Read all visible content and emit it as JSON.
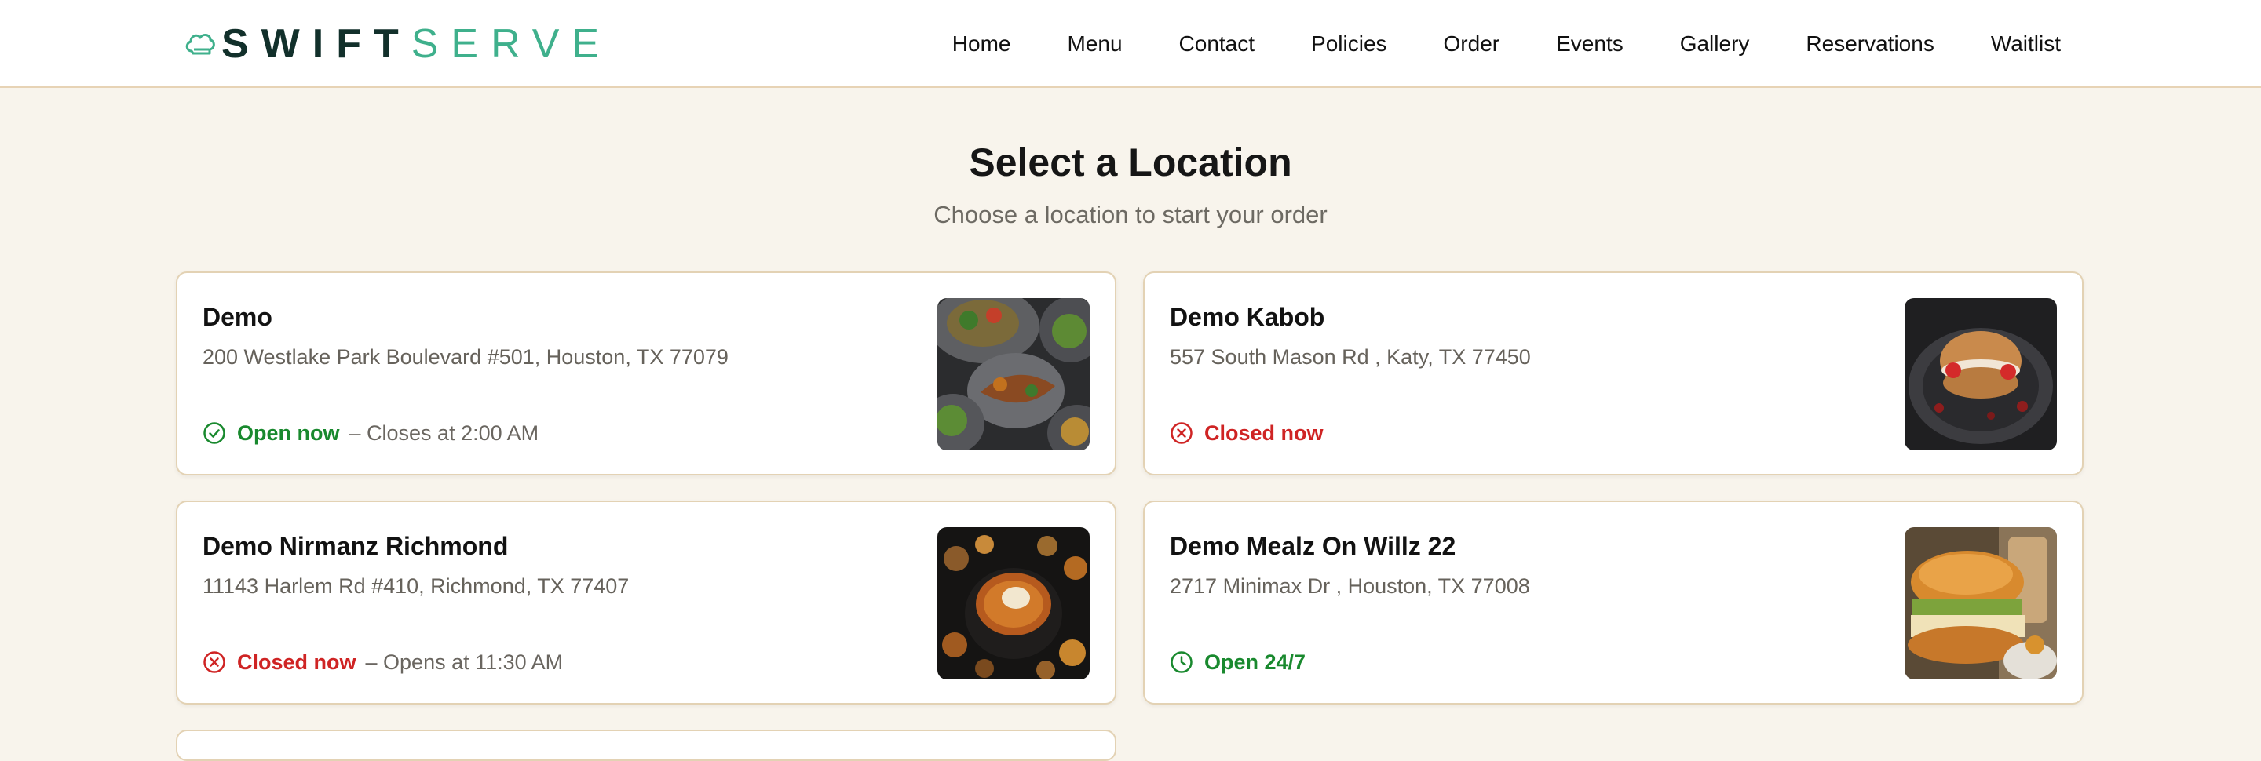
{
  "brand": {
    "name_bold": "SWIFT",
    "name_light": "SERVE",
    "icon": "chef-hat-icon"
  },
  "nav": [
    "Home",
    "Menu",
    "Contact",
    "Policies",
    "Order",
    "Events",
    "Gallery",
    "Reservations",
    "Waitlist"
  ],
  "page": {
    "title": "Select a Location",
    "subtitle": "Choose a location to start your order"
  },
  "locations": [
    {
      "name": "Demo",
      "address": "200 Westlake Park Boulevard #501, Houston, TX 77079",
      "status": "Open now",
      "status_detail": "– Closes at 2:00 AM",
      "status_icon": "check-circle-icon"
    },
    {
      "name": "Demo Kabob",
      "address": "557 South Mason Rd , Katy, TX 77450",
      "status": "Closed now",
      "status_detail": "",
      "status_icon": "x-circle-icon"
    },
    {
      "name": "Demo Nirmanz Richmond",
      "address": "11143 Harlem Rd #410, Richmond, TX 77407",
      "status": "Closed now",
      "status_detail": "– Opens at 11:30 AM",
      "status_icon": "x-circle-icon"
    },
    {
      "name": "Demo Mealz On Willz 22",
      "address": "2717 Minimax Dr , Houston, TX 77008",
      "status": "Open 24/7",
      "status_detail": "",
      "status_icon": "clock-icon"
    }
  ],
  "colors": {
    "background": "#f8f4ec",
    "card_border": "#e3d2b4",
    "brand_dark": "#12302b",
    "brand_accent": "#3fb08c",
    "open": "#19892e",
    "closed": "#cf2424"
  }
}
